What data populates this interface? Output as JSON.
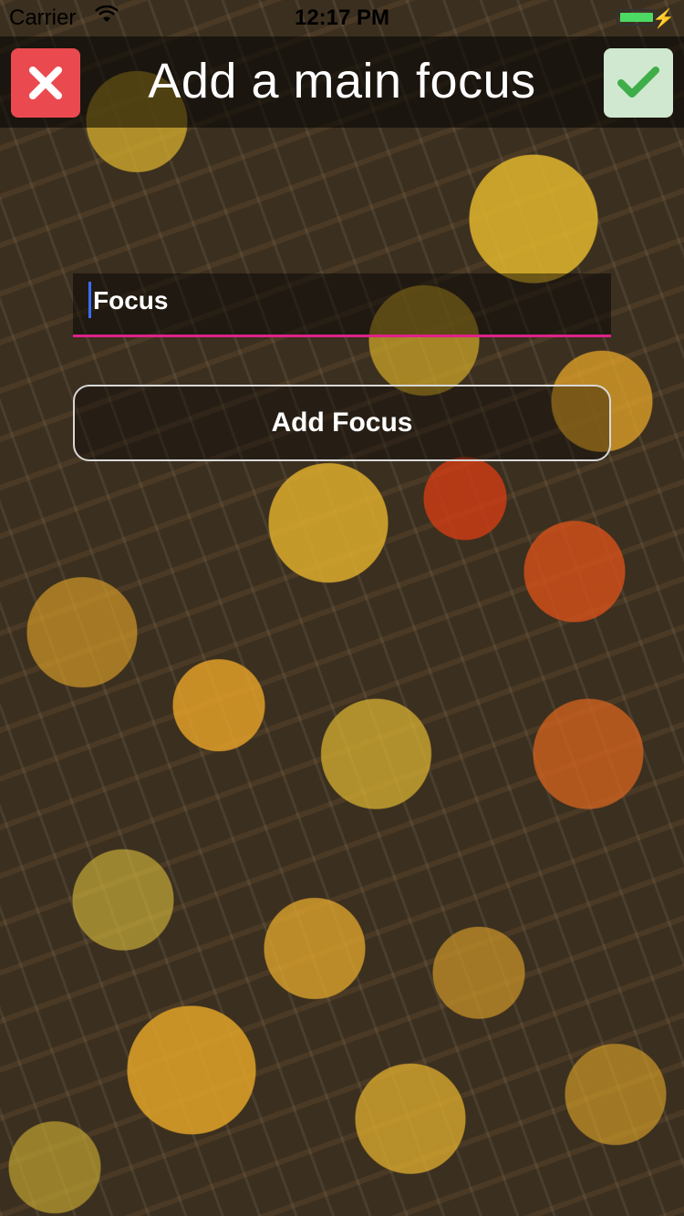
{
  "status_bar": {
    "carrier": "Carrier",
    "time": "12:17 PM",
    "battery_color": "#4cd964"
  },
  "header": {
    "title": "Add a main focus",
    "close_icon": "close-x-icon",
    "confirm_icon": "checkmark-icon",
    "close_color": "#ea4a4f",
    "confirm_color": "#cfe8cf"
  },
  "form": {
    "focus_value": "Focus",
    "add_button_label": "Add Focus",
    "underline_color": "#e0218a"
  }
}
